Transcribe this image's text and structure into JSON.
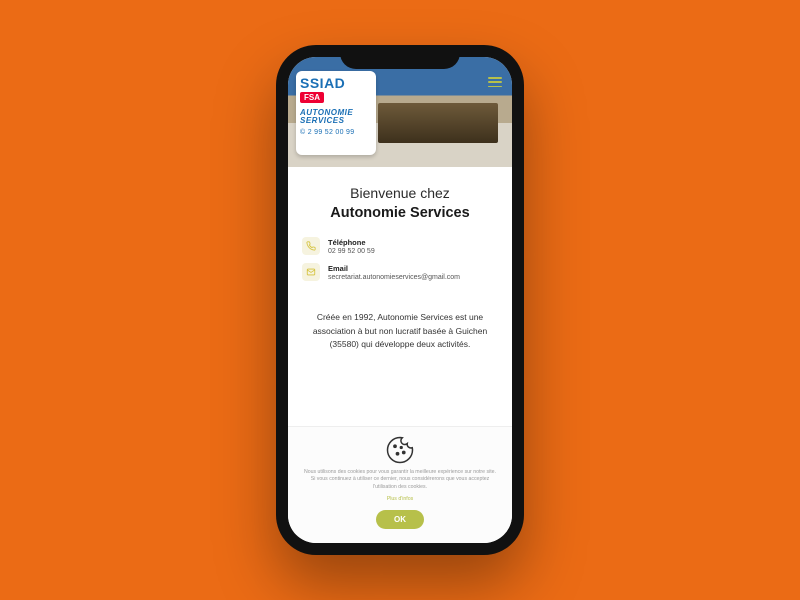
{
  "sign": {
    "logo": "SSIAD",
    "fsa": "FSA",
    "name1": "AUTONOMIE",
    "name2": "SERVICES",
    "tel": "© 2 99 52 00 99"
  },
  "titles": {
    "welcome": "Bienvenue chez",
    "name": "Autonomie Services"
  },
  "contacts": {
    "phone": {
      "label": "Téléphone",
      "value": "02 99 52 00 59"
    },
    "email": {
      "label": "Email",
      "value": "secretariat.autonomieservices@gmail.com"
    }
  },
  "paragraph": "Créée en 1992, Autonomie Services est une association à but non lucratif basée à Guichen (35580) qui développe deux activités.",
  "cookie": {
    "text": "Nous utilisons des cookies pour vous garantir la meilleure expérience sur notre site. Si vous continuez à utiliser ce dernier, nous considérerons que vous acceptez l'utilisation des cookies.",
    "more": "Plus d'infos",
    "ok": "OK"
  }
}
